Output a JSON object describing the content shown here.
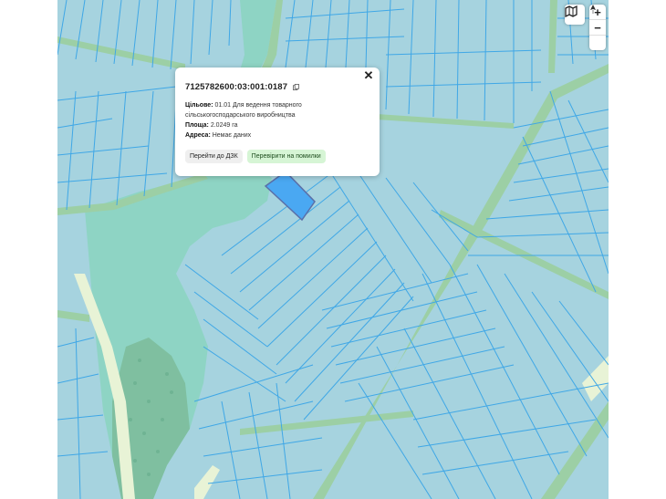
{
  "map": {
    "colors": {
      "field": "#a6d3df",
      "parcel_line": "#3fa7e6",
      "water": "#8ed4c4",
      "road_green": "#9ccfa5",
      "forest": "#8bc8b0",
      "selected": "#4aa8f2",
      "road_light": "#e8f3d6"
    }
  },
  "popup": {
    "cadastral_number": "7125782600:03:001:0187",
    "purpose_label": "Цільове:",
    "purpose_value": "01.01 Для ведення товарного сільськогосподарського виробництва",
    "area_label": "Площа:",
    "area_value": "2.0249 га",
    "address_label": "Адреса:",
    "address_value": "Немає даних",
    "btn_dzk": "Перейти до ДЗК",
    "btn_check": "Перевірити на помилки",
    "close_icon": "close-icon",
    "copy_icon": "copy-icon"
  },
  "controls": {
    "layers_icon": "map-layers-icon",
    "zoom_in": "+",
    "zoom_out": "−",
    "compass_icon": "north-arrow-icon"
  }
}
